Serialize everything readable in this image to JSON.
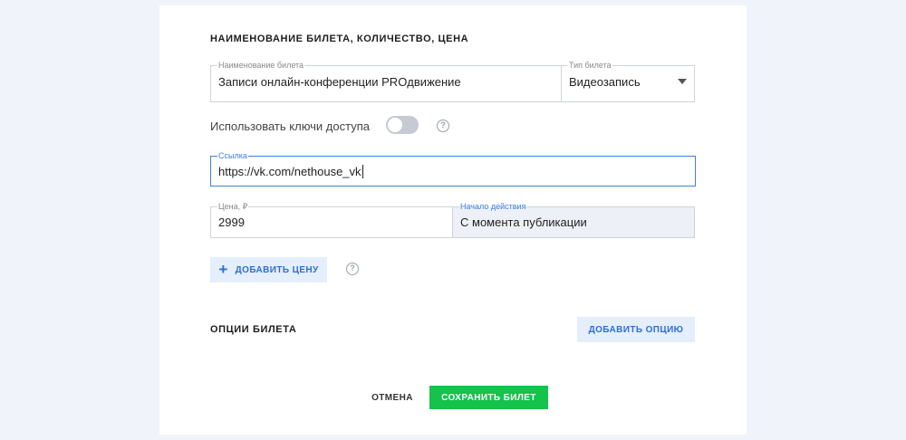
{
  "section_ticket": {
    "title": "НАИМЕНОВАНИЕ БИЛЕТА, КОЛИЧЕСТВО, ЦЕНА"
  },
  "ticket_name": {
    "label": "Наименование билета",
    "value": "Записи онлайн-конференции PROдвижение"
  },
  "ticket_type": {
    "label": "Тип билета",
    "value": "Видеозапись",
    "icon": "chevron-down-icon"
  },
  "access_keys": {
    "label": "Использовать ключи доступа",
    "enabled": false,
    "help": "?"
  },
  "link": {
    "label": "Ссылка",
    "value": "https://vk.com/nethouse_vk"
  },
  "price": {
    "label": "Цена, ₽",
    "value": "2999"
  },
  "start": {
    "label": "Начало действия",
    "value": "С момента публикации"
  },
  "add_price": {
    "label": "ДОБАВИТЬ ЦЕНУ",
    "icon": "+",
    "help": "?"
  },
  "section_options": {
    "title": "ОПЦИИ БИЛЕТА",
    "add_option_label": "ДОБАВИТЬ ОПЦИЮ"
  },
  "actions": {
    "cancel_label": "ОТМЕНА",
    "save_label": "СОХРАНИТЬ БИЛЕТ"
  },
  "colors": {
    "accent": "#2b6fd6",
    "focus_border": "#3f7fdc",
    "save": "#14c24c",
    "page_bg": "#f0f3f9"
  }
}
